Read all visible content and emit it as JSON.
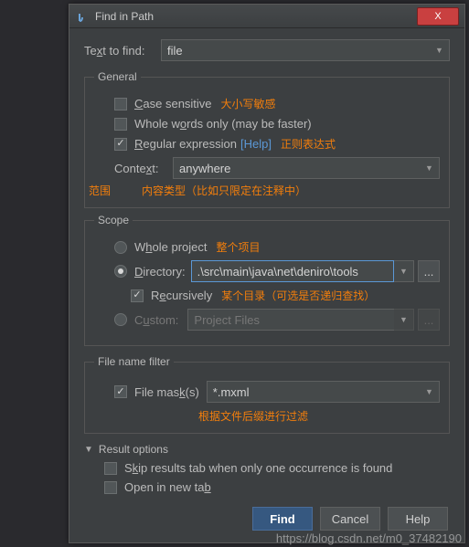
{
  "window": {
    "title": "Find in Path",
    "close": "X"
  },
  "text_to_find": {
    "label": "Text to find:",
    "value": "file"
  },
  "general": {
    "legend": "General",
    "case_sensitive": {
      "label": "Case sensitive",
      "checked": false,
      "note": "大小写敏感"
    },
    "whole_words": {
      "label": "Whole words only (may be faster)",
      "checked": false
    },
    "regex": {
      "label": "Regular expression",
      "checked": true,
      "help": "[Help]",
      "note": "正则表达式"
    },
    "context": {
      "label": "Context:",
      "value": "anywhere"
    },
    "scope_note_top": "范围",
    "scope_note_bottom": "内容类型（比如只限定在注释中）"
  },
  "scope": {
    "legend": "Scope",
    "whole_project": {
      "label": "Whole project",
      "checked": false,
      "note": "整个项目"
    },
    "directory": {
      "label": "Directory:",
      "checked": true,
      "value": ".\\src\\main\\java\\net\\deniro\\tools"
    },
    "recursively": {
      "label": "Recursively",
      "checked": true,
      "note": "某个目录（可选是否递归查找）"
    },
    "custom": {
      "label": "Custom:",
      "checked": false,
      "value": "Project Files"
    }
  },
  "file_filter": {
    "legend": "File name filter",
    "file_mask": {
      "label": "File mask(s)",
      "checked": true,
      "value": "*.mxml"
    },
    "note": "根据文件后缀进行过滤"
  },
  "result_options": {
    "header": "Result options",
    "skip_tab": {
      "label": "Skip results tab when only one occurrence is found",
      "checked": false
    },
    "open_new_tab": {
      "label": "Open in new tab",
      "checked": false
    }
  },
  "buttons": {
    "find": "Find",
    "cancel": "Cancel",
    "help": "Help"
  },
  "watermark": "https://blog.csdn.net/m0_37482190",
  "ellipsis": "..."
}
